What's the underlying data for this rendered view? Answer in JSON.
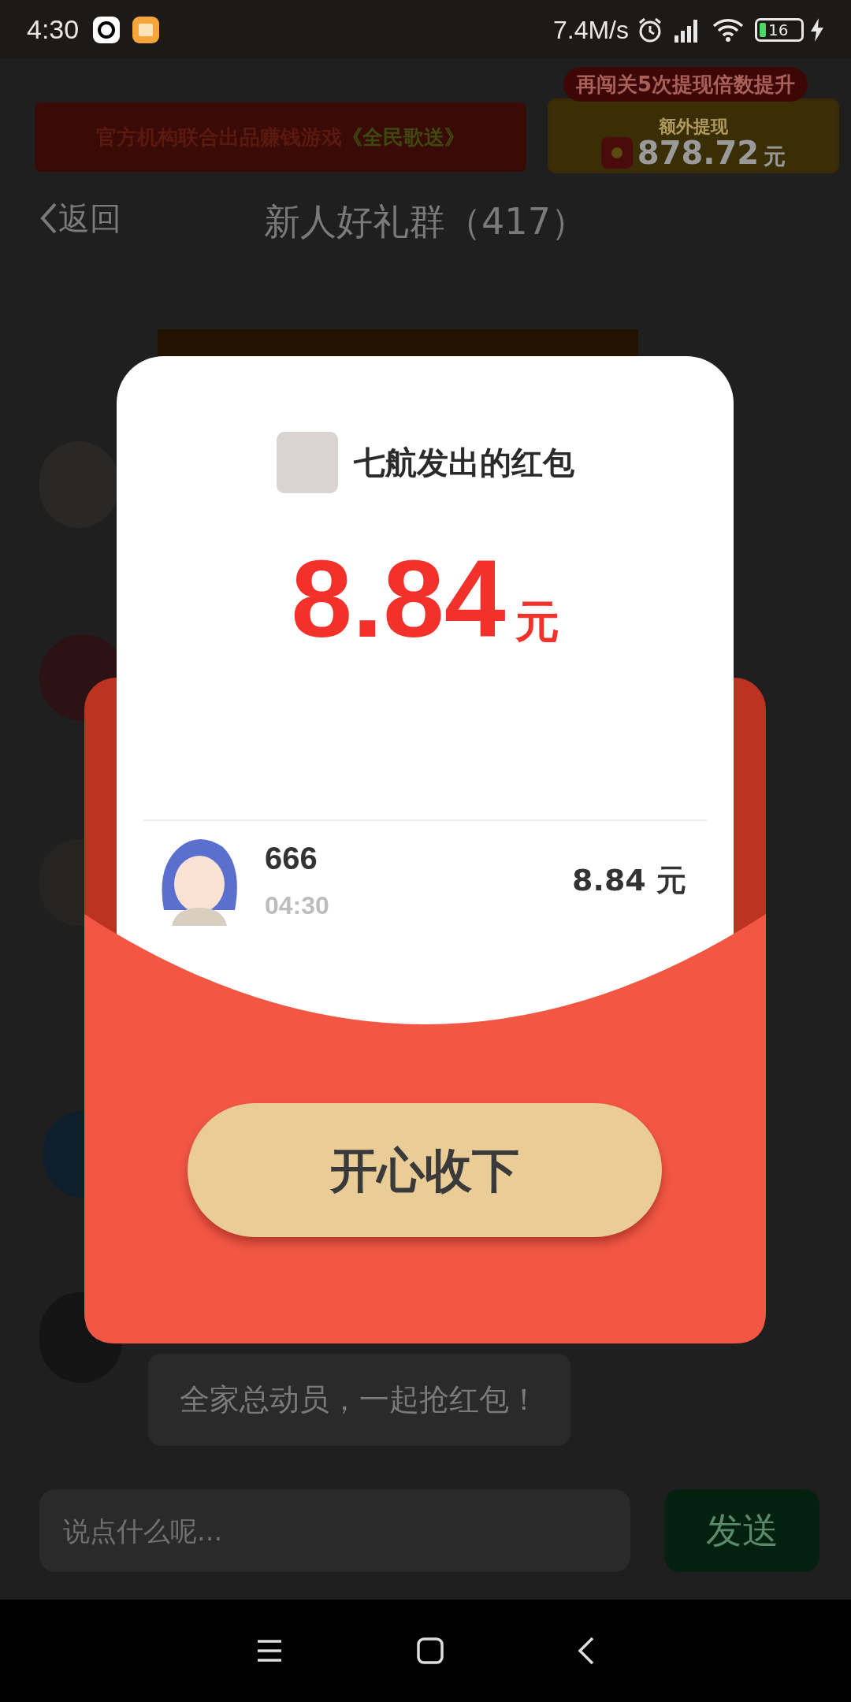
{
  "status_bar": {
    "time": "4:30",
    "speed": "7.4M/s",
    "battery": "16"
  },
  "banner": {
    "text": "官方机构联合出品赚钱游戏",
    "highlight": "《全民歌送》",
    "badge": "再闯关5次提现倍数提升",
    "extra_label": "额外提现",
    "extra_amount": "878.72",
    "extra_unit": "元"
  },
  "header": {
    "back": "返回",
    "title": "新人好礼群（417）"
  },
  "messages": [
    {
      "text": "全家总动员，一起抢红包！"
    }
  ],
  "input": {
    "placeholder": "说点什么呢...",
    "send": "发送"
  },
  "red_packet": {
    "sender": "七航发出的红包",
    "amount": "8.84",
    "unit": "元",
    "recipients": [
      {
        "name": "666",
        "time": "04:30",
        "amount": "8.84 元"
      }
    ],
    "button": "开心收下"
  }
}
